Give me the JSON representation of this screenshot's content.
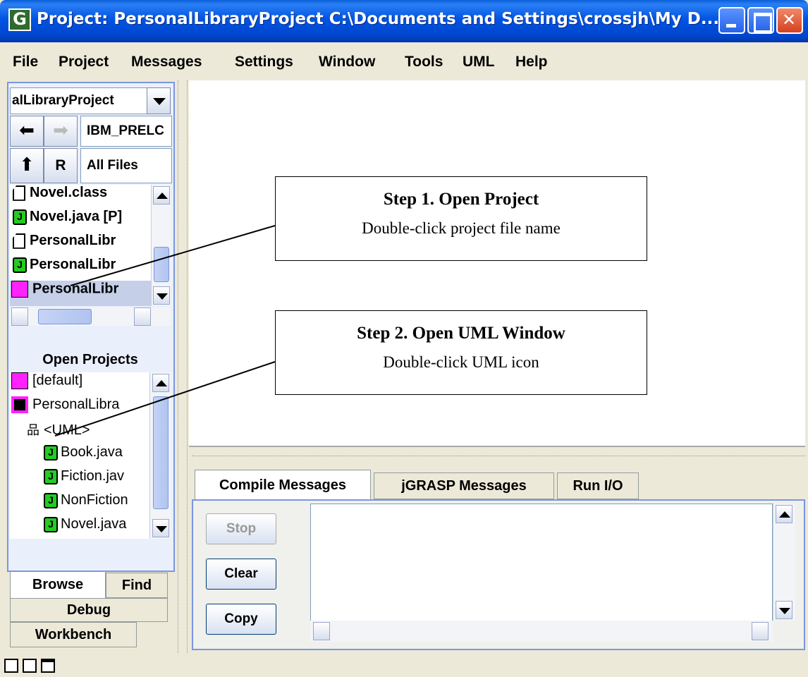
{
  "window": {
    "title": "Project: PersonalLibraryProject  C:\\Documents and Settings\\crossjh\\My D...",
    "app_icon_letter": "G"
  },
  "menu": [
    "File",
    "Project",
    "Messages",
    "Settings",
    "Window",
    "Tools",
    "UML",
    "Help"
  ],
  "browse": {
    "project_combo": "alLibraryProject",
    "path_field": "IBM_PRELC",
    "refresh_label": "R",
    "filter_field": "All Files",
    "files": [
      {
        "name": "Novel.class",
        "icon": "file-icon"
      },
      {
        "name": "Novel.java [P]",
        "icon": "java-file-icon"
      },
      {
        "name": "PersonalLibr",
        "icon": "file-icon"
      },
      {
        "name": "PersonalLibr",
        "icon": "java-file-icon"
      },
      {
        "name": "PersonalLibr",
        "icon": "project-file-icon"
      }
    ]
  },
  "open_projects": {
    "header": "Open Projects",
    "items": [
      {
        "name": "[default]",
        "icon": "project-file-icon"
      },
      {
        "name": "PersonalLibra",
        "icon": "open-project-icon"
      },
      {
        "name": "<UML>",
        "icon": "uml-icon"
      },
      {
        "name": "Book.java",
        "icon": "java-file-icon"
      },
      {
        "name": "Fiction.jav",
        "icon": "java-file-icon"
      },
      {
        "name": "NonFiction",
        "icon": "java-file-icon"
      },
      {
        "name": "Novel.java",
        "icon": "java-file-icon"
      }
    ]
  },
  "left_tabs": {
    "browse": "Browse",
    "find": "Find",
    "debug": "Debug",
    "workbench": "Workbench"
  },
  "message_tabs": [
    "Compile Messages",
    "jGRASP Messages",
    "Run I/O"
  ],
  "message_buttons": {
    "stop": "Stop",
    "clear": "Clear",
    "copy": "Copy"
  },
  "callouts": [
    {
      "title": "Step 1. Open Project",
      "subtitle": "Double-click project file name"
    },
    {
      "title": "Step 2. Open UML Window",
      "subtitle": "Double-click UML icon"
    }
  ],
  "colors": {
    "titlebar": "#0054E3",
    "panel_border": "#7A96DF",
    "project_icon": "#FF22FF",
    "java_icon": "#22CC22"
  }
}
